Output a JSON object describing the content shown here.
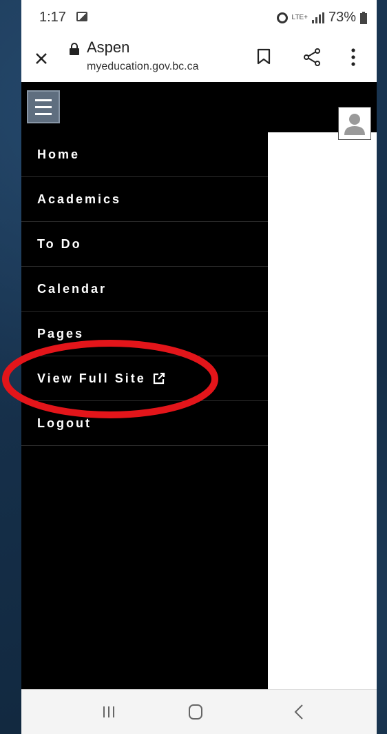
{
  "status_bar": {
    "time": "1:17",
    "network": "LTE+",
    "battery": "73%"
  },
  "browser": {
    "site_name": "Aspen",
    "url": "myeducation.gov.bc.ca"
  },
  "menu": {
    "items": [
      {
        "label": "Home"
      },
      {
        "label": "Academics"
      },
      {
        "label": "To Do"
      },
      {
        "label": "Calendar"
      },
      {
        "label": "Pages"
      },
      {
        "label": "View Full Site"
      },
      {
        "label": "Logout"
      }
    ]
  },
  "colors": {
    "menu_background": "#000000",
    "menu_text": "#ffffff",
    "highlight_annotation": "#e3151a",
    "hamburger_button": "#5f6e7f"
  },
  "icons": {
    "hamburger": "hamburger-menu-icon",
    "external_link": "external-link-icon",
    "avatar": "user-avatar-icon"
  }
}
